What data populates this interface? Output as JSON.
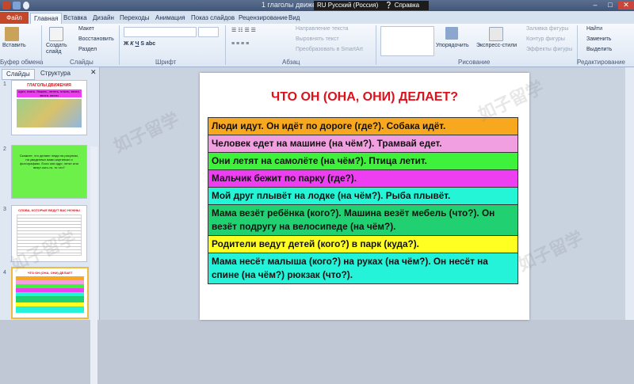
{
  "window": {
    "title": "1 глаголы движения",
    "language": "RU Русский (Россия)",
    "help": "Справка",
    "accent": "#c4472a"
  },
  "tabs": [
    "Файл",
    "Главная",
    "Вставка",
    "Дизайн",
    "Переходы",
    "Анимация",
    "Показ слайдов",
    "Рецензирование",
    "Вид"
  ],
  "ribbon": {
    "paste": "Вставить",
    "new_slide": "Создать слайд",
    "layout": "Макет",
    "reset": "Восстановить",
    "section": "Раздел",
    "text_direction": "Направление текста",
    "align_text": "Выровнять текст",
    "convert_smartart": "Преобразовать в SmartArt",
    "arrange": "Упорядочить",
    "quick_styles": "Экспресс-стили",
    "shape_fill": "Заливка фигуры",
    "shape_outline": "Контур фигуры",
    "shape_effects": "Эффекты фигуры",
    "find": "Найти",
    "replace": "Заменить",
    "select": "Выделить",
    "groups": {
      "clipboard": "Буфер обмена",
      "slides": "Слайды",
      "font": "Шрифт",
      "paragraph": "Абзац",
      "drawing": "Рисование",
      "editing": "Редактирование"
    }
  },
  "left_pane": {
    "tab_slides": "Слайды",
    "tab_outline": "Структура",
    "thumbs": [
      {
        "num": "1",
        "title": "ГЛАГОЛЫ ДВИЖЕНИЯ",
        "sub": "идти, ехать, бежать, лететь, плыть, везти, вести, нести"
      },
      {
        "num": "2",
        "text": "Скажите, что делают люди на рисунках, на увиденных вами картинках и фотографиях. Если они идут, летят или везут кого-то, то что?"
      },
      {
        "num": "3",
        "title": "СЛОВА, КОТОРЫЕ ВЕДУТ ВАС НУЖНЫ"
      },
      {
        "num": "4",
        "title": "ЧТО ОН (ОНА, ОНИ) ДЕЛАЕТ"
      }
    ]
  },
  "slide": {
    "title": "ЧТО ОН (ОНА, ОНИ) ДЕЛАЕТ?",
    "rows": [
      {
        "text": "Люди идут. Он идёт по дороге (где?). Собака идёт.",
        "color": "#f7a81e"
      },
      {
        "text": "Человек едет на машине (на чём?). Трамвай едет.",
        "color": "#f19fe0"
      },
      {
        "text": "Они летят на самолёте (на чём?). Птица летит.",
        "color": "#3ef23b"
      },
      {
        "text": "Мальчик бежит по парку (где?).",
        "color": "#ed3ef2"
      },
      {
        "text": "Мой друг плывёт на лодке (на чём?). Рыба плывёт.",
        "color": "#24f5d6"
      },
      {
        "text": "Мама везёт ребёнка (кого?). Машина везёт мебель (что?). Он везёт подругу на велосипеде (на чём?).",
        "color": "#21d070"
      },
      {
        "text": "Родители ведут детей (кого?) в парк (куда?).",
        "color": "#ffff22"
      },
      {
        "text": "Мама несёт малыша (кого?) на руках (на чём?). Он несёт на спине (на чём?) рюкзак (что?).",
        "color": "#24f2d9"
      }
    ]
  },
  "watermark": "如子留学"
}
